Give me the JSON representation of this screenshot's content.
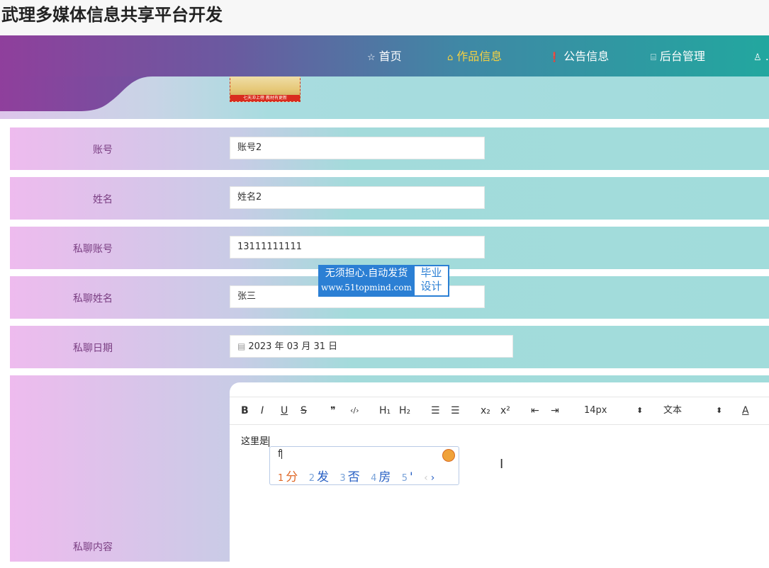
{
  "site": {
    "title": "武理多媒体信息共享平台开发"
  },
  "nav": {
    "items": [
      {
        "label": "首页",
        "icon": "star-icon",
        "glyph": "☆"
      },
      {
        "label": "作品信息",
        "icon": "bag-icon",
        "glyph": "⌂",
        "active": true
      },
      {
        "label": "公告信息",
        "icon": "alert-icon",
        "glyph": "❗"
      },
      {
        "label": "后台管理",
        "icon": "building-icon",
        "glyph": "⌸"
      },
      {
        "label": "…",
        "icon": "user-icon",
        "glyph": "♙"
      }
    ]
  },
  "cover": {
    "caption": "七天冲上榜 教材有更新"
  },
  "form": {
    "account": {
      "label": "账号",
      "value": "账号2"
    },
    "name": {
      "label": "姓名",
      "value": "姓名2"
    },
    "chat_account": {
      "label": "私聊账号",
      "value": "13111111111"
    },
    "chat_name": {
      "label": "私聊姓名",
      "value": "张三"
    },
    "chat_date": {
      "label": "私聊日期",
      "value": "2023 年 03 月 31 日"
    },
    "chat_content": {
      "label": "私聊内容"
    }
  },
  "editor": {
    "toolbar": {
      "bold": "B",
      "italic": "I",
      "underline": "U",
      "strike": "S",
      "quote": "❞",
      "code": "‹/›",
      "h1": "H₁",
      "h2": "H₂",
      "ordered_list": "☰",
      "bullet_list": "☰",
      "subscript": "x₂",
      "superscript": "x²",
      "outdent": "⇤",
      "indent": "⇥",
      "font_size": "14px",
      "header": "文本",
      "color": "A"
    },
    "content": "这里是"
  },
  "ime": {
    "input": "f",
    "candidates": [
      {
        "num": "1",
        "text": "分"
      },
      {
        "num": "2",
        "text": "发"
      },
      {
        "num": "3",
        "text": "否"
      },
      {
        "num": "4",
        "text": "房"
      },
      {
        "num": "5",
        "text": "'"
      }
    ],
    "prev": "‹",
    "next": "›"
  },
  "watermark": {
    "line1": "无须担心.自动发货",
    "line2": "www.51topmind.com",
    "tag1": "毕业",
    "tag2": "设计"
  }
}
